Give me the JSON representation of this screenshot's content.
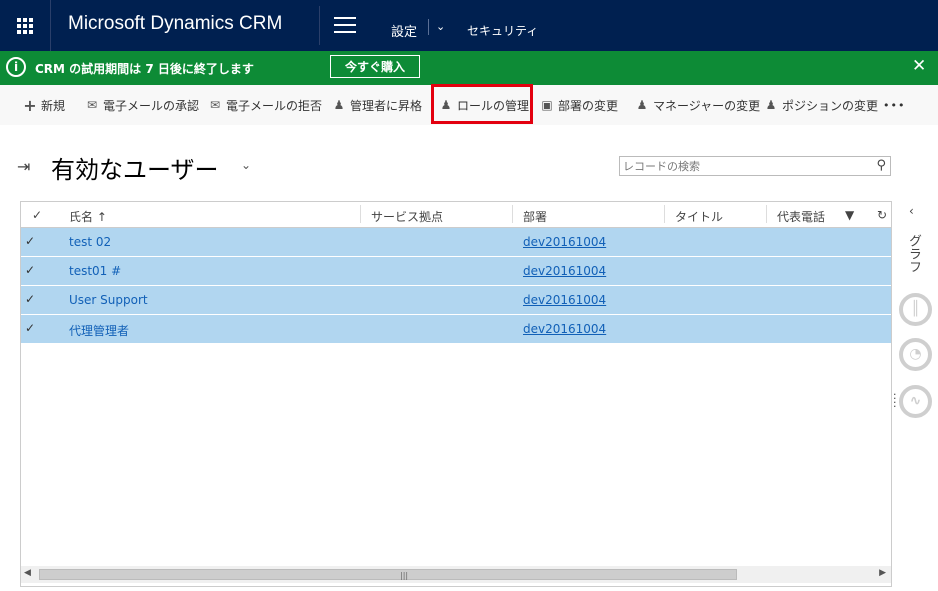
{
  "header": {
    "app_title": "Microsoft Dynamics CRM",
    "nav_settings": "設定",
    "nav_security": "セキュリティ"
  },
  "trial": {
    "message": "CRM の試用期間は 7 日後に終了します",
    "buy_label": "今すぐ購入"
  },
  "commands": {
    "new": "新規",
    "approve_email": "電子メールの承認",
    "reject_email": "電子メールの拒否",
    "promote_admin": "管理者に昇格",
    "manage_roles": "ロールの管理",
    "change_dept": "部署の変更",
    "change_manager": "マネージャーの変更",
    "change_position": "ポジションの変更",
    "more": "•••"
  },
  "view": {
    "title": "有効なユーザー",
    "search_placeholder": "レコードの検索"
  },
  "grid": {
    "columns": {
      "name": "氏名 ↑",
      "service_site": "サービス拠点",
      "dept": "部署",
      "title": "タイトル",
      "phone": "代表電話"
    },
    "rows": [
      {
        "name": "test 02",
        "dept": "dev20161004"
      },
      {
        "name": "test01 #",
        "dept": "dev20161004"
      },
      {
        "name": "User Support",
        "dept": "dev20161004"
      },
      {
        "name": "代理管理者",
        "dept": "dev20161004"
      }
    ]
  },
  "sidepanel": {
    "label": "グラフ"
  },
  "colors": {
    "header_bg": "#002050",
    "trial_bg": "#0d8b36",
    "row_selected": "#b1d6f0",
    "link": "#1160b7",
    "highlight": "#e3000f"
  }
}
